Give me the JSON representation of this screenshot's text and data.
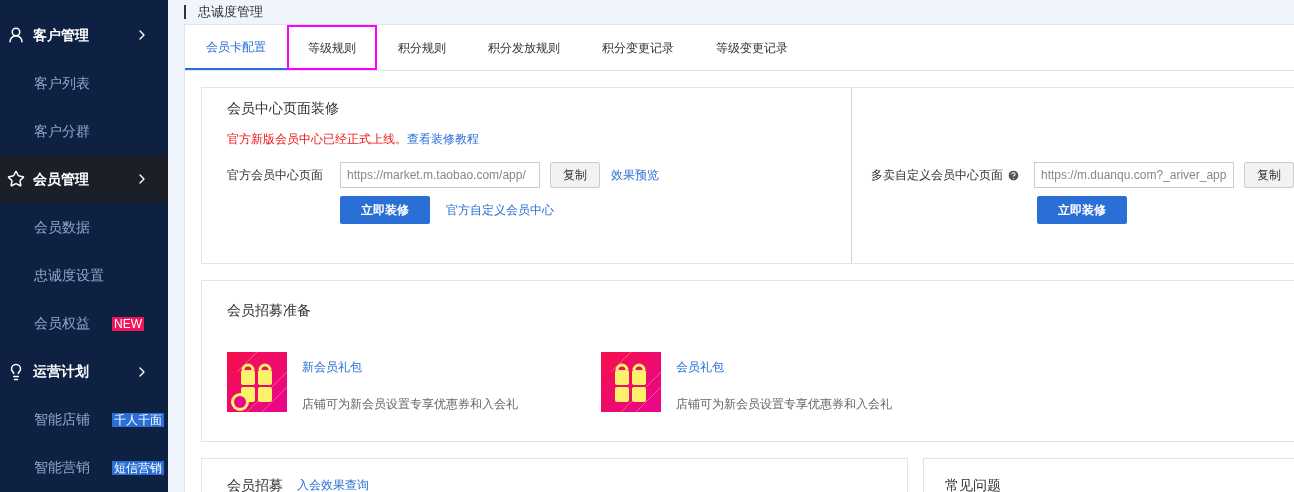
{
  "sidebar": {
    "items": [
      {
        "kind": "group",
        "label": "客户管理",
        "selected": false
      },
      {
        "kind": "item",
        "label": "客户列表"
      },
      {
        "kind": "item",
        "label": "客户分群"
      },
      {
        "kind": "group",
        "label": "会员管理",
        "selected": true
      },
      {
        "kind": "item",
        "label": "会员数据"
      },
      {
        "kind": "item",
        "label": "忠诚度设置"
      },
      {
        "kind": "item",
        "label": "会员权益",
        "badge": {
          "text": "NEW",
          "color": "#f0145a"
        }
      },
      {
        "kind": "group",
        "label": "运营计划",
        "selected": false
      },
      {
        "kind": "item",
        "label": "智能店铺",
        "badge": {
          "text": "千人千面",
          "color": "#2a6fd6"
        }
      },
      {
        "kind": "item",
        "label": "智能营销",
        "badge": {
          "text": "短信营销",
          "color": "#2a6fd6"
        }
      }
    ]
  },
  "page_title": "忠诚度管理",
  "tabs": [
    {
      "label": "会员卡配置",
      "selected": true,
      "highlighted": false
    },
    {
      "label": "等级规则",
      "selected": false,
      "highlighted": true
    },
    {
      "label": "积分规则",
      "selected": false,
      "highlighted": false
    },
    {
      "label": "积分发放规则",
      "selected": false,
      "highlighted": false
    },
    {
      "label": "积分变更记录",
      "selected": false,
      "highlighted": false
    },
    {
      "label": "等级变更记录",
      "selected": false,
      "highlighted": false
    }
  ],
  "decoration": {
    "title": "会员中心页面装修",
    "notice": "官方新版会员中心已经正式上线。",
    "notice_link": "查看装修教程",
    "left": {
      "label": "官方会员中心页面",
      "value": "https://market.m.taobao.com/app/",
      "copy": "复制",
      "preview": "效果预览",
      "button": "立即装修",
      "link": "官方自定义会员中心"
    },
    "right": {
      "label": "多卖自定义会员中心页面",
      "value": "https://m.duanqu.com?_ariver_app",
      "copy": "复制",
      "button": "立即装修"
    }
  },
  "recruit_prep": {
    "title": "会员招募准备",
    "items": [
      {
        "title": "新会员礼包",
        "desc": "店铺可为新会员设置专享优惠券和入会礼",
        "new": true
      },
      {
        "title": "会员礼包",
        "desc": "店铺可为新会员设置专享优惠券和入会礼",
        "new": false
      }
    ]
  },
  "recruit": {
    "title": "会员招募",
    "link": "入会效果查询"
  },
  "faq": {
    "title": "常见问题"
  }
}
